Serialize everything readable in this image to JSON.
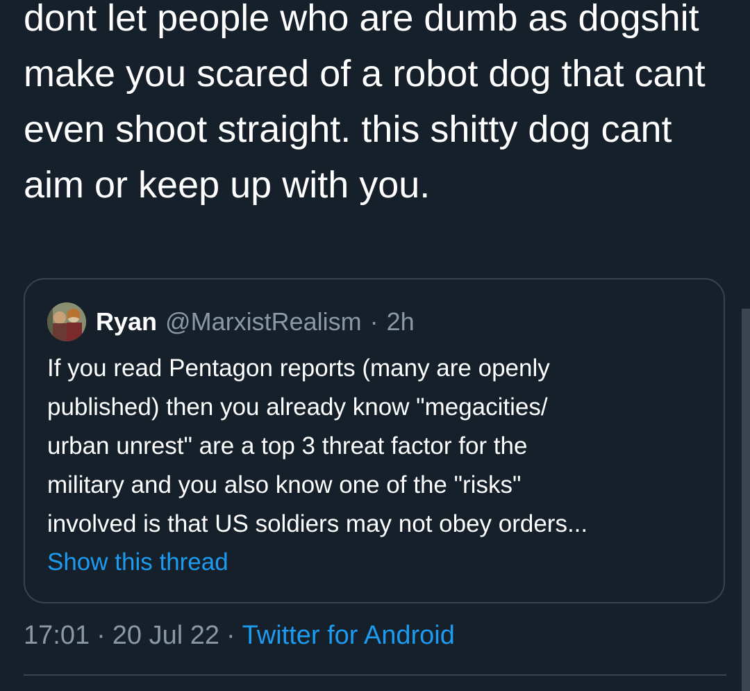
{
  "tweet": {
    "text": "dont let people who are dumb as dogshit make you scared of a robot dog that cant even shoot straight. this shitty dog cant aim or keep up with you."
  },
  "quoted_tweet": {
    "author_name": "Ryan",
    "author_handle": "@MarxistRealism",
    "separator": "·",
    "time_ago": "2h",
    "text": "If you read Pentagon reports (many are openly\npublished) then you already know \"megacities/\nurban unrest\" are a top 3 threat factor for the\nmilitary and you also know one of the \"risks\"\ninvolved is that US soldiers may not obey orders...",
    "show_thread_label": "Show this thread",
    "avatar_icon": "avatar-illustration"
  },
  "meta": {
    "time": "17:01",
    "date": "20 Jul 22",
    "separator": "·",
    "source": "Twitter for Android"
  },
  "colors": {
    "background": "#15202b",
    "text_primary": "#ffffff",
    "text_secondary": "#8b98a5",
    "link": "#1d9bf0",
    "border": "#38444d"
  }
}
